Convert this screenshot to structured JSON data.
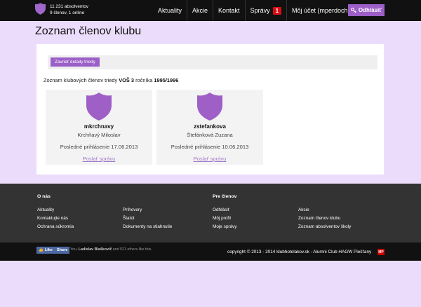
{
  "header": {
    "graduates_count": "11 231 absolventov",
    "members_online": "9 členov, 1 online",
    "nav": [
      "Aktuality",
      "Akcie",
      "Kontakt",
      "Správy",
      "Môj účet (mperdoch)"
    ],
    "messages_badge": "1",
    "logout_label": "Odhlásiť",
    "accent": "#9c5fc7"
  },
  "page": {
    "title": "Zoznam členov klubu",
    "toggle_label": "Zavrieť detaily triedy",
    "intro_prefix": "Zoznam klubových členov triedy",
    "class_name": "VOŠ 3",
    "intro_mid": "ročníka",
    "year": "1995/1996"
  },
  "members": [
    {
      "username": "mkrchnavy",
      "fullname": "Krchňavý Miloslav",
      "last_login": "Posledné prihlásenie 17.06.2013",
      "send_label": "Poslať správu"
    },
    {
      "username": "zstefankova",
      "fullname": "Štefánková Zuzana",
      "last_login": "Posledné prihlásenie 10.06.2013",
      "send_label": "Poslať správu"
    }
  ],
  "footer": {
    "about_heading": "O nás",
    "members_heading": "Pre členov",
    "about_col1": [
      "Aktuality",
      "Kontaktujte nás",
      "Ochrana súkromia"
    ],
    "about_col2": [
      "Príhovory",
      "Štatút",
      "Dokumenty na stiahnutie"
    ],
    "members_col1": [
      "Odhlásiť",
      "Môj profil",
      "Moje správy"
    ],
    "members_col2": [
      "Akcie",
      "Zoznam členov klubu",
      "Zoznam absolventov školy"
    ]
  },
  "bottom": {
    "fb_like": "Like",
    "fb_share": "Share",
    "fb_prefix": "You,",
    "fb_name": "Ladislav Blaškovič",
    "fb_suffix": "and 521 others like this.",
    "copyright": "copyright © 2013 - 2014 klubhotelakov.sk - Alumni Club HAGW Piešťany",
    "mp_badge": "MP"
  }
}
